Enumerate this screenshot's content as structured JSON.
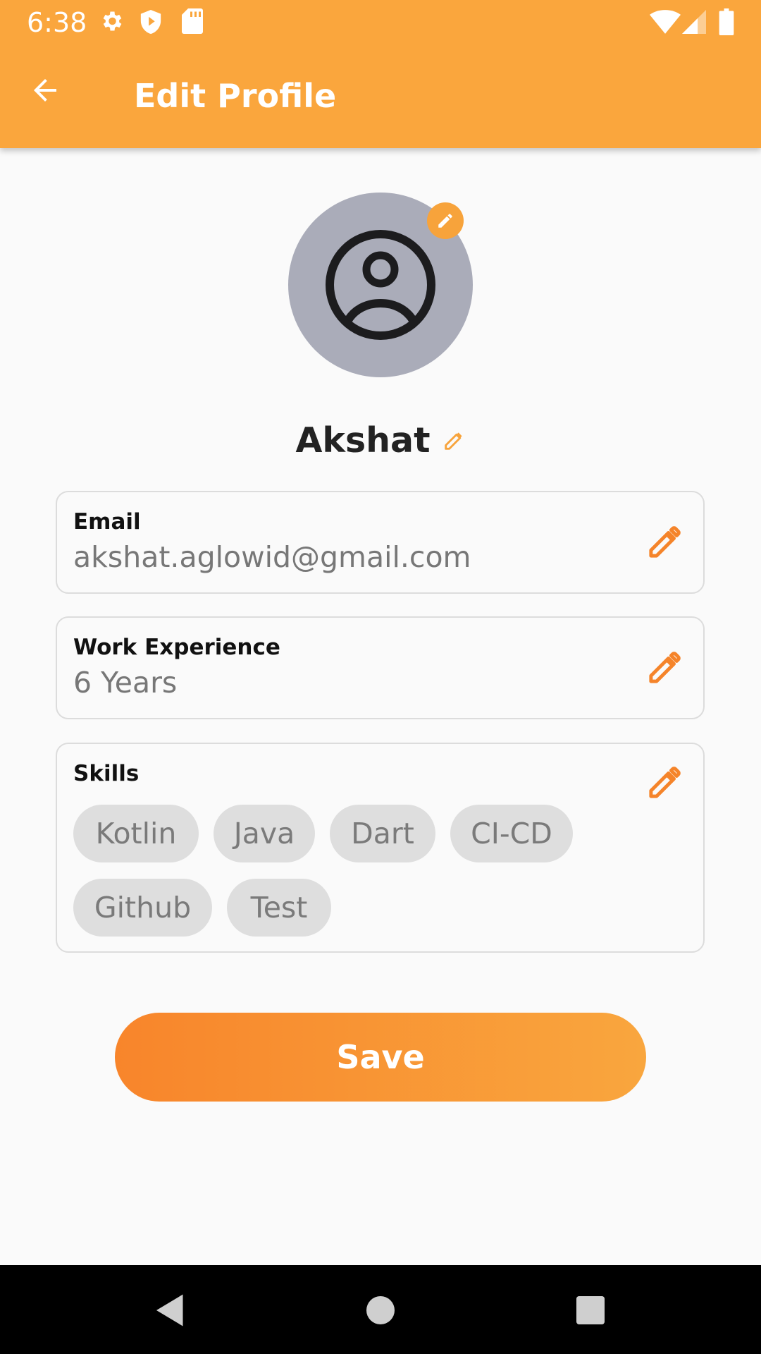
{
  "status_bar": {
    "time": "6:38",
    "icons": [
      "settings-icon",
      "shield-icon",
      "sd-card-icon",
      "wifi-icon",
      "signal-icon",
      "battery-icon"
    ]
  },
  "app_bar": {
    "back_icon": "arrow-left-icon",
    "title": "Edit Profile",
    "background_color": "#faa63d"
  },
  "profile": {
    "avatar_icon": "account-circle-icon",
    "avatar_edit_icon": "pencil-icon",
    "name": "Akshat",
    "name_edit_icon": "pencil-icon"
  },
  "fields": {
    "email": {
      "label": "Email",
      "value": "akshat.aglowid@gmail.com",
      "edit_icon": "pencil-icon"
    },
    "work_experience": {
      "label": "Work Experience",
      "value": "6 Years",
      "edit_icon": "pencil-icon"
    },
    "skills": {
      "label": "Skills",
      "edit_icon": "pencil-icon",
      "chips": [
        "Kotlin",
        "Java",
        "Dart",
        "CI-CD",
        "Github",
        "Test"
      ]
    }
  },
  "save_button": {
    "label": "Save",
    "gradient": [
      "#f8852b",
      "#f9a63e"
    ]
  },
  "nav_bar": {
    "icons": [
      "back-triangle-icon",
      "home-circle-icon",
      "recents-square-icon"
    ]
  },
  "colors": {
    "accent": "#f7a33b",
    "edit_icon": "#f5842a",
    "chip_bg": "#dedede",
    "avatar_bg": "#aaacb9"
  }
}
